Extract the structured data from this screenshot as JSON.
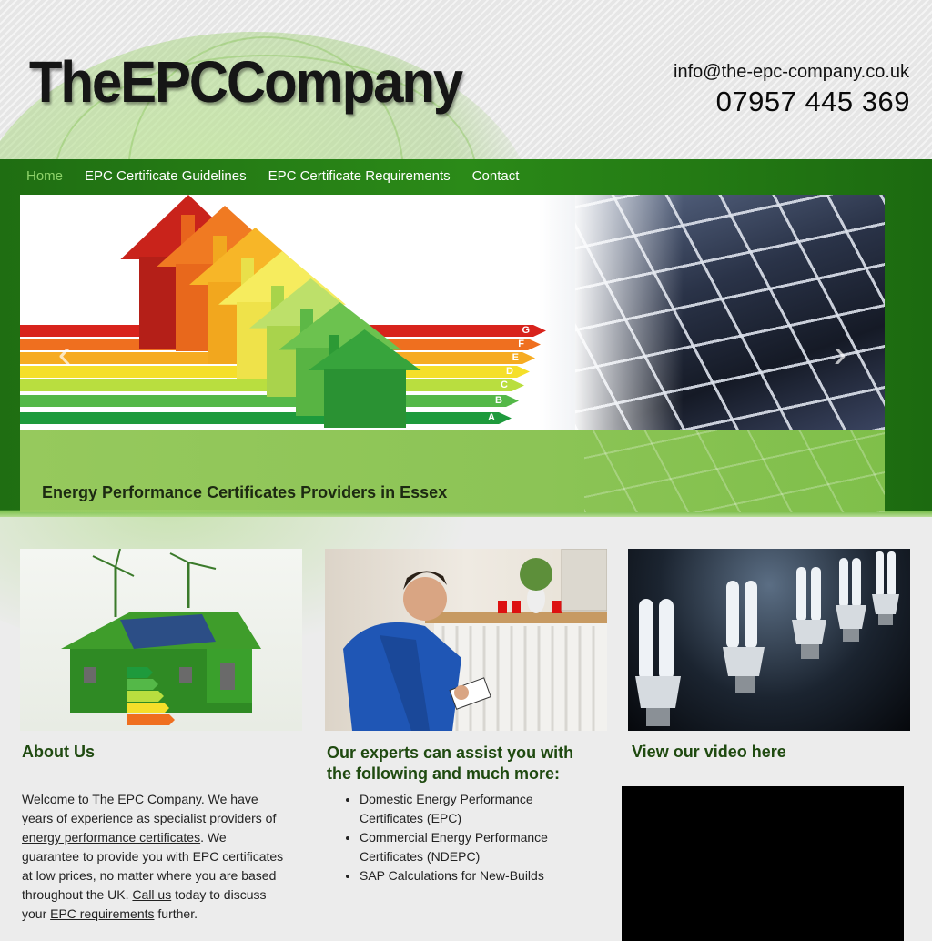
{
  "header": {
    "logo_text": "TheEPCCompany",
    "email": "info@the-epc-company.co.uk",
    "phone": "07957 445 369"
  },
  "nav": {
    "items": [
      {
        "label": "Home",
        "active": true
      },
      {
        "label": "EPC Certificate Guidelines",
        "active": false
      },
      {
        "label": "EPC Certificate Requirements",
        "active": false
      },
      {
        "label": "Contact",
        "active": false
      }
    ]
  },
  "slider": {
    "caption": "Energy Performance Certificates Providers in Essex",
    "prev_icon": "chevron-left-icon",
    "next_icon": "chevron-right-icon",
    "prev_glyph": "‹",
    "next_glyph": "›",
    "ratings": [
      "G",
      "F",
      "E",
      "D",
      "C",
      "B",
      "A"
    ]
  },
  "about": {
    "heading": "About Us",
    "text_1": "Welcome to The EPC Company. We have years of experience as specialist providers of ",
    "link_1": "energy performance certificates",
    "text_2": ". We guarantee to provide you with EPC certificates at low prices, no matter where you are based throughout the UK. ",
    "link_2": "Call us",
    "text_3": " today to discuss your ",
    "link_3": "EPC requirements",
    "text_4": " further."
  },
  "services": {
    "heading": "Our experts can assist you with the following and much more:",
    "items": [
      "Domestic Energy Performance Certificates (EPC)",
      "Commercial Energy Performance Certificates (NDEPC)",
      "SAP Calculations for New-Builds"
    ]
  },
  "video": {
    "heading": "View our video here"
  },
  "colors": {
    "nav_green": "#2b8a18",
    "active_nav": "#8fd36a",
    "heading_green": "#1f4a10"
  }
}
